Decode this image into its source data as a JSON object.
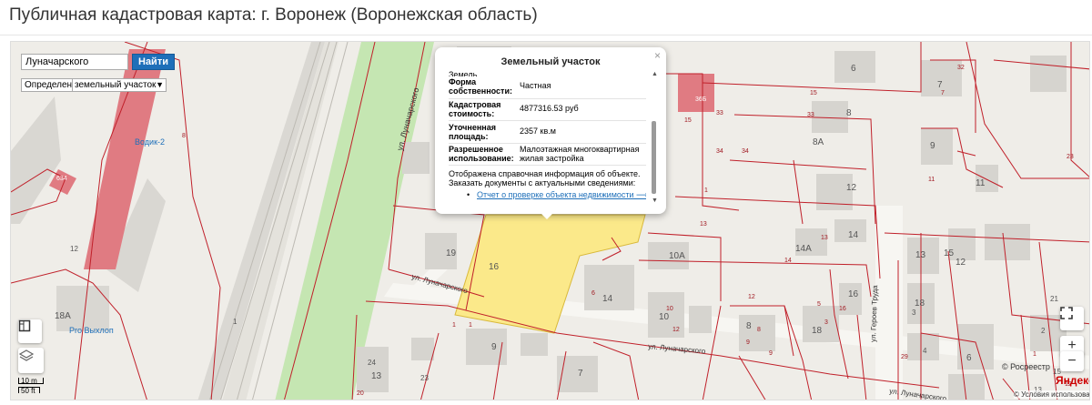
{
  "page": {
    "title": "Публичная кадастровая карта: г. Воронеж (Воронежская область)"
  },
  "search": {
    "value": "Луначарского",
    "button_label": "Найти"
  },
  "definition": {
    "label": "Определение:",
    "selected": "земельный участок"
  },
  "popup": {
    "title": "Земельный участок",
    "close": "×",
    "cut_label": "Земель",
    "rows": [
      {
        "key": "Форма собственности:",
        "value": "Частная"
      },
      {
        "key": "Кадастровая стоимость:",
        "value": "4877316.53 руб"
      },
      {
        "key": "Уточненная площадь:",
        "value": "2357 кв.м"
      },
      {
        "key": "Разрешенное использование:",
        "value": "Малоэтажная многоквартирная жилая застройка"
      }
    ],
    "note": "Отображена справочная информация об объекте. Заказать документы с актуальными сведениями:",
    "link": "Отчет о проверке объекта недвижимости ⟶"
  },
  "map_labels": {
    "streets": [
      "ул. Луначарского",
      "ул. Луначарского",
      "ул. Луначарского",
      "ул. Луначарского",
      "ул. Героев Труда"
    ],
    "poi": [
      "Pro Выхлоп",
      "Водик-2"
    ],
    "house_numbers": [
      "6",
      "7",
      "8",
      "8A",
      "9",
      "11",
      "12",
      "13",
      "14",
      "14A",
      "10A",
      "10",
      "16",
      "18",
      "19",
      "14",
      "16",
      "18",
      "15",
      "12",
      "8",
      "7",
      "9",
      "13",
      "24",
      "23",
      "18A",
      "12",
      "21",
      "6",
      "2",
      "1",
      "3",
      "15",
      "13",
      "4"
    ],
    "parcel_numbers": [
      "36Б",
      "15",
      "33",
      "33",
      "34",
      "34",
      "15",
      "32",
      "23",
      "1",
      "13",
      "13",
      "14",
      "5",
      "3",
      "29",
      "7",
      "8",
      "10",
      "12",
      "16",
      "1",
      "1",
      "9",
      "6",
      "12",
      "9",
      "11",
      "12",
      "1",
      "8",
      "20",
      "634"
    ]
  },
  "scale": {
    "metric": "10 m",
    "imperial": "50 ft"
  },
  "attribution": {
    "brand": "Яндекс",
    "terms": "© Условия использования",
    "copy": "© Росреестр"
  },
  "icons": {
    "layers": "layers-icon",
    "ruler": "ruler-icon",
    "fullscreen": "fullscreen-icon",
    "zoom_in": "zoom-in-icon",
    "zoom_out": "zoom-out-icon"
  },
  "colors": {
    "parcel_border": "#c0202a",
    "selected_parcel": "#fbe98a",
    "building_pink": "#e07b82",
    "greenery": "#c5e6b2",
    "link": "#1e6fb9"
  }
}
